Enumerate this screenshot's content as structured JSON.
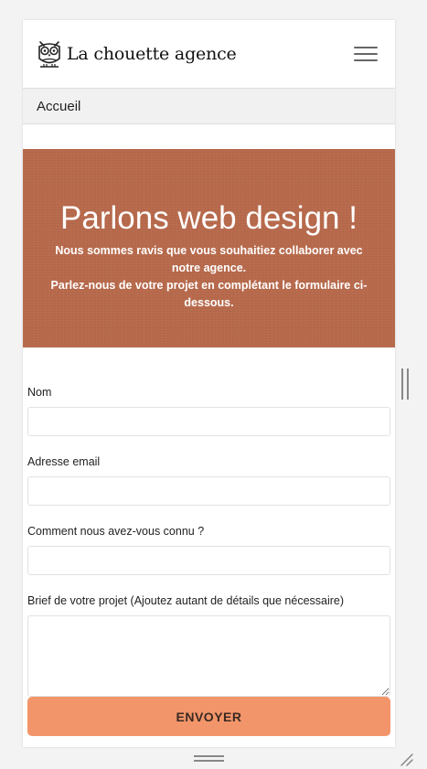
{
  "header": {
    "brand_name": "La chouette agence",
    "logo_icon": "owl-icon",
    "menu_icon": "hamburger-menu-icon"
  },
  "breadcrumb": {
    "label": "Accueil"
  },
  "hero": {
    "title": "Parlons web design !",
    "line1": "Nous sommes ravis que vous souhaitiez collaborer avec notre agence.",
    "line2": "Parlez-nous de votre projet en complétant le formulaire ci-dessous.",
    "background_color": "#b86a4c"
  },
  "form": {
    "name_label": "Nom",
    "name_value": "",
    "email_label": "Adresse email",
    "email_value": "",
    "source_label": "Comment nous avez-vous connu ?",
    "source_value": "",
    "brief_label": "Brief de votre projet (Ajoutez autant de détails que nécessaire)",
    "brief_value": "",
    "submit_label": "ENVOYER",
    "submit_color": "#f3956a"
  }
}
